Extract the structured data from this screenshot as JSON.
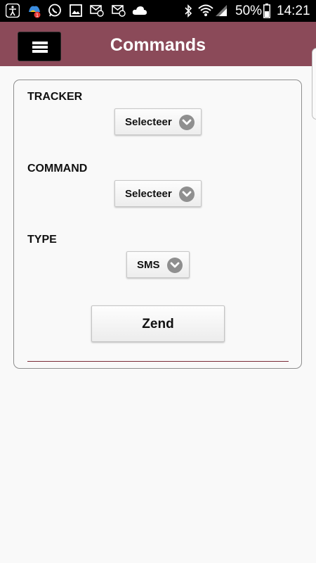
{
  "status_bar": {
    "battery": "50%",
    "time": "14:21",
    "icons": [
      "accessibility-icon",
      "notification-app-icon",
      "whatsapp-icon",
      "gallery-icon",
      "email-icon",
      "email-icon",
      "cloud-icon",
      "bluetooth-icon",
      "wifi-icon",
      "signal-icon",
      "battery-icon"
    ]
  },
  "header": {
    "title": "Commands",
    "menu_icon": "hamburger-menu-icon",
    "background": "#8b4a59"
  },
  "form": {
    "tracker": {
      "label": "TRACKER",
      "value": "Selecteer"
    },
    "command": {
      "label": "COMMAND",
      "value": "Selecteer"
    },
    "type": {
      "label": "TYPE",
      "value": "SMS"
    },
    "send_label": "Zend"
  },
  "colors": {
    "divider": "#7a2a36",
    "chevron": "#8f8f8f"
  }
}
